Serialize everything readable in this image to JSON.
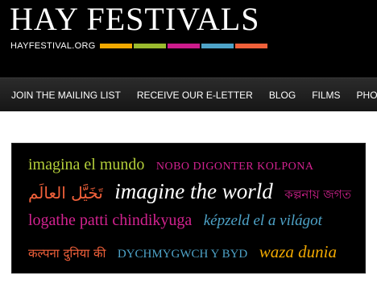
{
  "header": {
    "title": "HAY FESTIVALS",
    "url": "HAYFESTIVAL.ORG",
    "color_bars": [
      "#f2a900",
      "#9bbb2e",
      "#cc1b8c",
      "#4ea3c8",
      "#f0603a"
    ]
  },
  "nav": {
    "items": [
      {
        "label": "JOIN THE MAILING LIST"
      },
      {
        "label": "RECEIVE OUR E-LETTER"
      },
      {
        "label": "BLOG"
      },
      {
        "label": "FILMS"
      },
      {
        "label": "PHO"
      }
    ]
  },
  "banner": {
    "rows": [
      [
        {
          "text": "imagina el mundo",
          "color": "#b4cf3a"
        },
        {
          "text": "NOBO DIGONTER KOLPONA",
          "color": "#d2228f"
        }
      ],
      [
        {
          "text": "تَخَيَّل العالَم",
          "color": "#f0603a"
        },
        {
          "text": "imagine the world",
          "color": "#ffffff"
        },
        {
          "text": "কল্পনায় জগত",
          "color": "#d2228f"
        }
      ],
      [
        {
          "text": "logathe patti chindikyuga",
          "color": "#d2228f"
        },
        {
          "text": "képzeld el a világot",
          "color": "#4ea3c8"
        }
      ],
      [
        {
          "text": "कल्पना दुनिया की",
          "color": "#f0603a"
        },
        {
          "text": "DYCHMYGWCH Y BYD",
          "color": "#4ea3c8"
        },
        {
          "text": "waza dunia",
          "color": "#f2a900"
        }
      ]
    ]
  }
}
